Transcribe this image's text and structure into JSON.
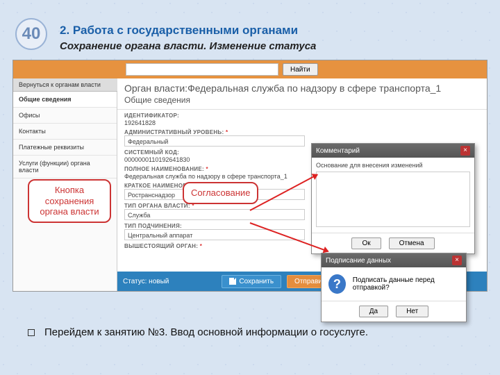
{
  "slide": {
    "number": "40",
    "title": "2. Работа с государственными органами",
    "subtitle": "Сохранение органа власти. Изменение статуса"
  },
  "topbar": {
    "search": "",
    "find": "Найти"
  },
  "back": "Вернуться к органам власти",
  "side": {
    "items": [
      {
        "label": "Общие сведения",
        "active": true
      },
      {
        "label": "Офисы"
      },
      {
        "label": "Контакты"
      },
      {
        "label": "Платежные реквизиты"
      },
      {
        "label": "Услуги (функции) органа власти"
      }
    ]
  },
  "main": {
    "title": "Орган власти:Федеральная служба по надзору в сфере транспорта_1",
    "section": "Общие сведения",
    "fields": {
      "id_lbl": "ИДЕНТИФИКАТОР:",
      "id_val": "192641828",
      "admin_lbl": "АДМИНИСТРАТИВНЫЙ УРОВЕНЬ:",
      "admin_val": "Федеральный",
      "sys_lbl": "СИСТЕМНЫЙ КОД:",
      "sys_val": "0000000110192641830",
      "full_lbl": "ПОЛНОЕ НАИМЕНОВАНИЕ:",
      "full_val": "Федеральная служба по надзору в сфере транспорта_1",
      "short_lbl": "КРАТКОЕ НАИМЕНОВАНИЕ:",
      "short_val": "Ространснадзор",
      "type_lbl": "ТИП ОРГАНА ВЛАСТИ:",
      "type_val": "Служба",
      "sub_lbl": "ТИП ПОДЧИНЕНИЯ:",
      "sub_val": "Центральный аппарат",
      "parent_lbl": "ВЫШЕСТОЯЩИЙ ОРГАН:"
    }
  },
  "status": {
    "label": "Статус: новый",
    "save": "Сохранить",
    "send": "Отправить на согласование"
  },
  "callouts": {
    "save": "Кнопка сохранения органа власти",
    "agree": "Согласование"
  },
  "dlg_comment": {
    "title": "Комментарий",
    "prompt": "Основание для внесения изменений",
    "ok": "Ок",
    "cancel": "Отмена"
  },
  "dlg_sign": {
    "title": "Подписание данных",
    "msg": "Подписать данные перед отправкой?",
    "yes": "Да",
    "no": "Нет"
  },
  "note": "Перейдем к занятию №3. Ввод основной информации о госуслуге."
}
